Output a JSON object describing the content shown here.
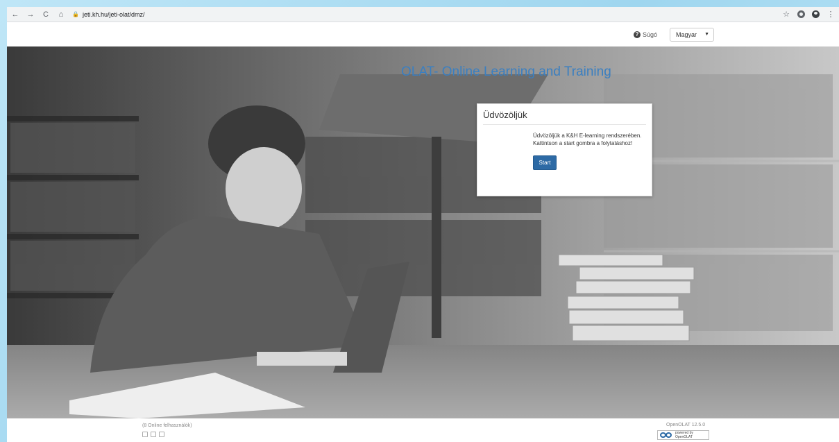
{
  "browser": {
    "url": "jeti.kh.hu/jeti-olat/dmz/",
    "nav_icons": {
      "back": "←",
      "forward": "→",
      "reload": "C",
      "home": "⌂"
    }
  },
  "header": {
    "help_label": "Súgó",
    "language": {
      "selected": "Magyar"
    }
  },
  "hero": {
    "title": "OLAT- Online Learning and Training"
  },
  "welcome": {
    "title": "Üdvözöljük",
    "text": "Üdvözöljük a K&H E-learning rendszerében. Kattintson a start gombra a folytatáshoz!",
    "start_label": "Start"
  },
  "footer": {
    "online_users": "(8 Online felhasználók)",
    "version": "OpenOLAT 12.5.0",
    "powered_line1": "powered by",
    "powered_line2": "OpenOLAT"
  },
  "colors": {
    "accent": "#2d6aa5",
    "title": "#3a7fc1",
    "frame": "#a9dcf2"
  }
}
